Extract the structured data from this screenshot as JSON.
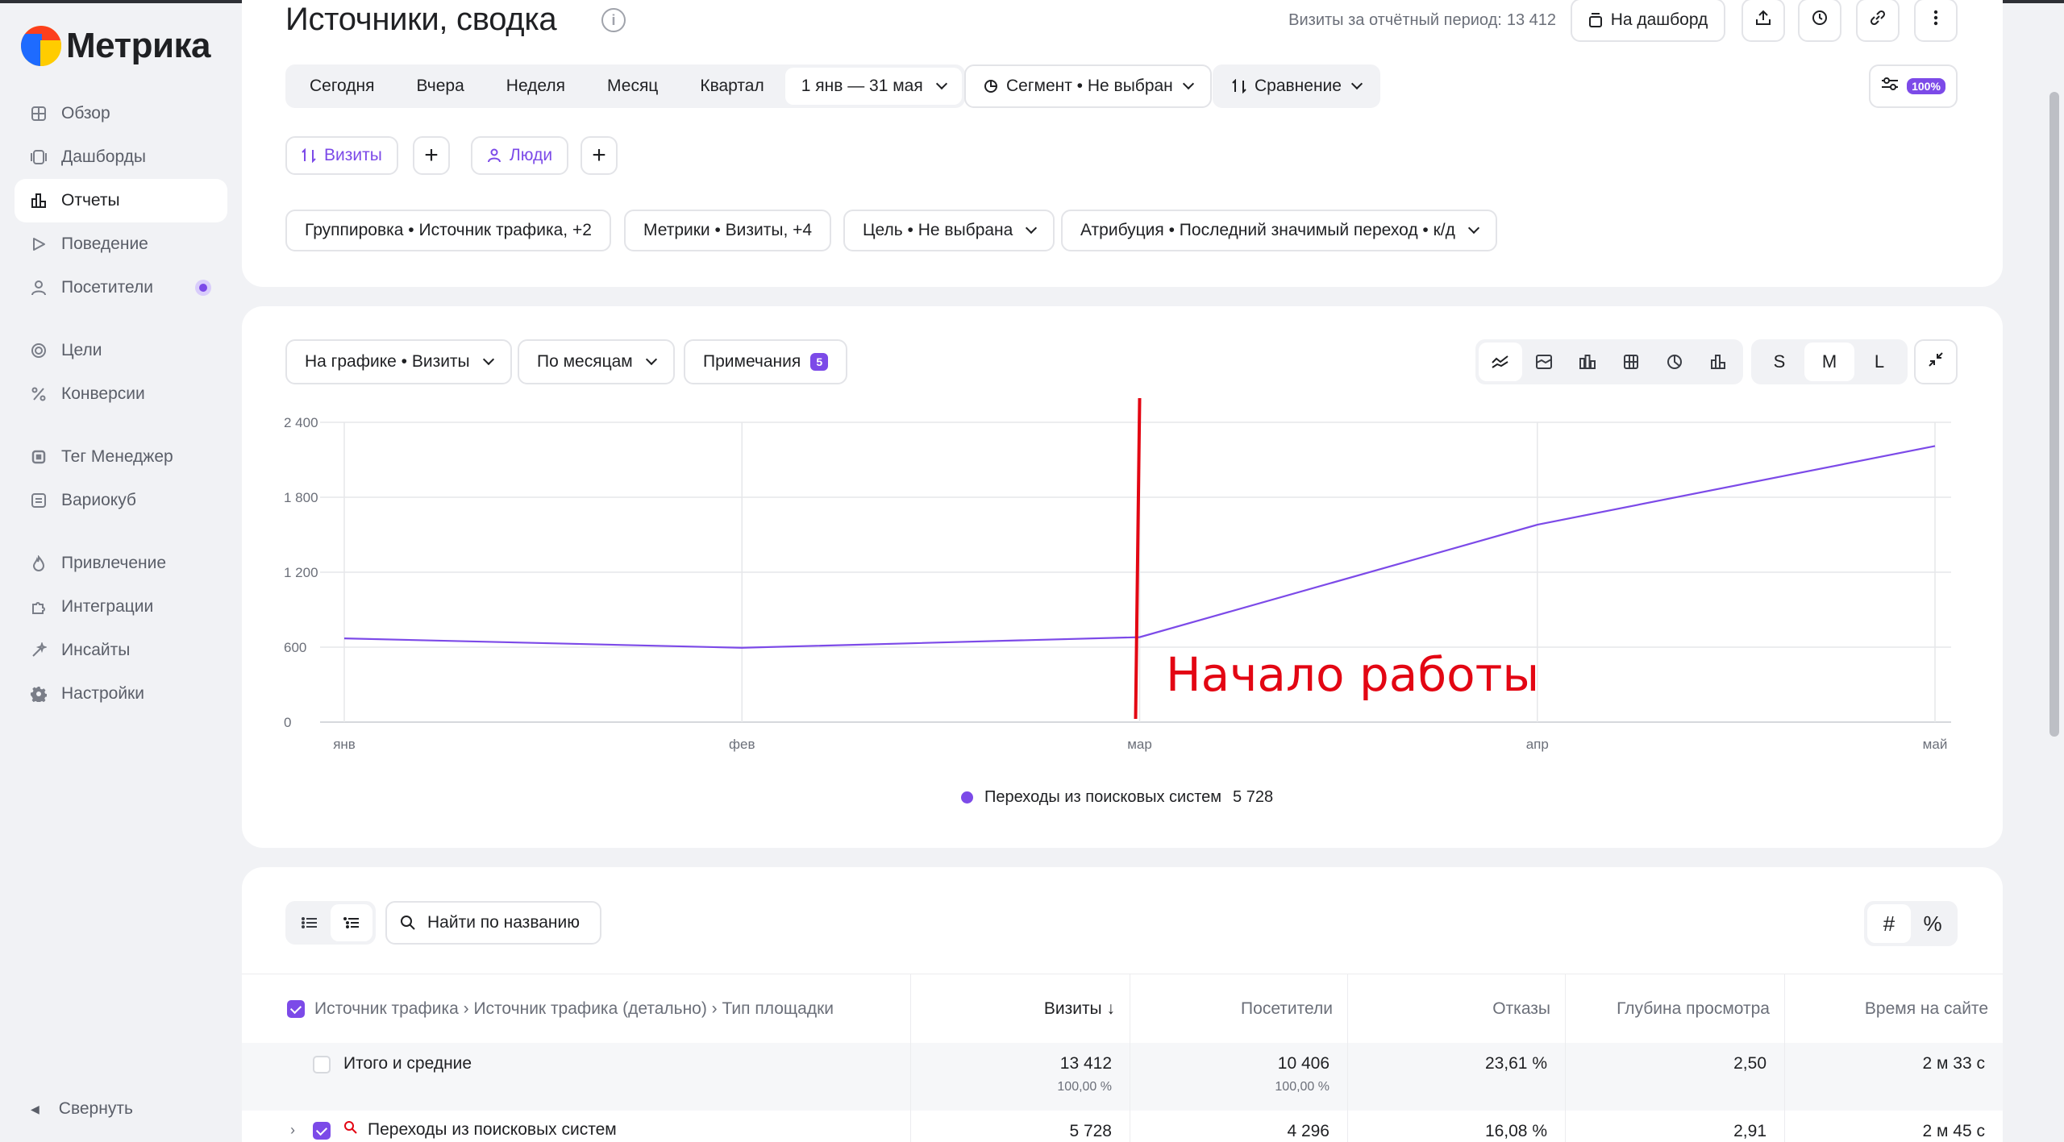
{
  "app": {
    "logo_text": "Метрика"
  },
  "sidebar": {
    "items": [
      {
        "label": "Обзор"
      },
      {
        "label": "Дашборды"
      },
      {
        "label": "Отчеты"
      },
      {
        "label": "Поведение"
      },
      {
        "label": "Посетители"
      },
      {
        "label": "Цели"
      },
      {
        "label": "Конверсии"
      },
      {
        "label": "Тег Менеджер"
      },
      {
        "label": "Вариокуб"
      },
      {
        "label": "Привлечение"
      },
      {
        "label": "Интеграции"
      },
      {
        "label": "Инсайты"
      },
      {
        "label": "Настройки"
      }
    ],
    "active": "Отчеты",
    "collapse_label": "Свернуть"
  },
  "header": {
    "title": "Источники, сводка",
    "visits_label": "Визиты за отчётный период:",
    "visits_value": "13 412",
    "dashboard_button": "На дашборд"
  },
  "filters": {
    "periods": [
      "Сегодня",
      "Вчера",
      "Неделя",
      "Месяц",
      "Квартал"
    ],
    "date_range": "1 янв — 31 мая",
    "segment": "Сегмент • Не выбран",
    "comparison": "Сравнение",
    "accuracy_badge": "100%"
  },
  "metric_chips": {
    "visits": "Визиты",
    "people": "Люди"
  },
  "settings_chips": {
    "grouping": "Группировка • Источник трафика, +2",
    "metrics": "Метрики • Визиты, +4",
    "goal": "Цель • Не выбрана",
    "attribution": "Атрибуция • Последний значимый переход • к/д"
  },
  "chart_toolbar": {
    "on_chart": "На графике • Визиты",
    "by_period": "По месяцам",
    "notes": "Примечания",
    "notes_count": "5",
    "sizes": [
      "S",
      "M",
      "L"
    ],
    "active_size": "M"
  },
  "chart_data": {
    "type": "line",
    "categories": [
      "янв",
      "фев",
      "мар",
      "апр",
      "май"
    ],
    "y_ticks": [
      "0",
      "600",
      "1 200",
      "1 800",
      "2 400"
    ],
    "ylim": [
      0,
      2400
    ],
    "series": [
      {
        "name": "Переходы из поисковых систем",
        "total": "5 728",
        "color": "#7c4ae8",
        "values": [
          670,
          595,
          680,
          1580,
          2210
        ]
      }
    ],
    "grid": true,
    "annotation": {
      "text": "Начало работы",
      "at_category": "мар",
      "color": "#e30613"
    }
  },
  "table": {
    "search_placeholder": "Найти по названию",
    "hash_label": "#",
    "pct_label": "%",
    "grouping_header": "Источник трафика › Источник трафика (детально) › Тип площадки",
    "columns": [
      "Визиты ↓",
      "Посетители",
      "Отказы",
      "Глубина просмотра",
      "Время на сайте"
    ],
    "total_row": {
      "label": "Итого и средние",
      "visits": "13 412",
      "visits_pct": "100,00 %",
      "visitors": "10 406",
      "visitors_pct": "100,00 %",
      "bounce": "23,61 %",
      "depth": "2,50",
      "time": "2 м 33 с"
    },
    "rows": [
      {
        "label": "Переходы из поисковых систем",
        "visits": "5 728",
        "visitors": "4 296",
        "bounce": "16,08 %",
        "depth": "2,91",
        "time": "2 м 45 с"
      }
    ]
  }
}
